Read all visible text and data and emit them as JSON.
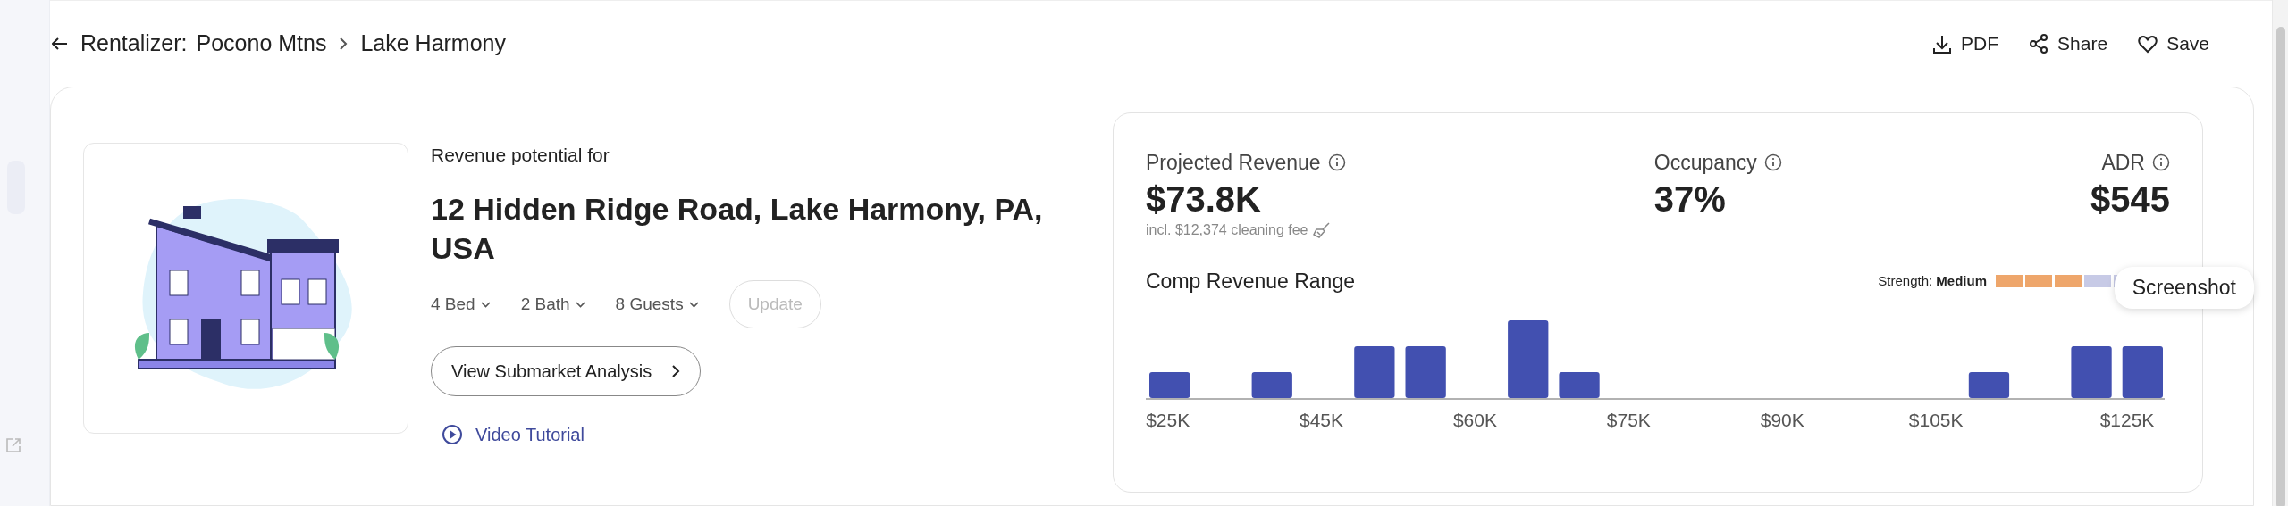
{
  "breadcrumb": {
    "root": "Rentalizer:",
    "market": "Pocono Mtns",
    "submarket": "Lake Harmony"
  },
  "actions": [
    {
      "kind": "download",
      "label": "PDF"
    },
    {
      "kind": "share",
      "label": "Share"
    },
    {
      "kind": "heart",
      "label": "Save"
    }
  ],
  "property": {
    "intro": "Revenue potential for",
    "address": "12 Hidden Ridge Road, Lake Harmony, PA, USA",
    "selectors": [
      {
        "label": "4 Bed"
      },
      {
        "label": "2 Bath"
      },
      {
        "label": "8 Guests"
      }
    ],
    "update_button": {
      "label": "Update",
      "disabled": true
    },
    "submarket_button": "View Submarket Analysis",
    "tutorial_link": "Video Tutorial"
  },
  "metrics": [
    {
      "label": "Projected Revenue",
      "value": "$73.8K",
      "note": "incl. $12,374 cleaning fee"
    },
    {
      "label": "Occupancy",
      "value": "37%"
    },
    {
      "label": "ADR",
      "value": "$545"
    }
  ],
  "comp_range": {
    "title": "Comp Revenue Range",
    "strength_label": "Strength:",
    "strength_value": "Medium",
    "level": 0.5,
    "axis_labels": [
      "$25K",
      "$45K",
      "$60K",
      "$75K",
      "$90K",
      "$105K",
      "$125K"
    ]
  },
  "tooltip": "Screenshot"
}
